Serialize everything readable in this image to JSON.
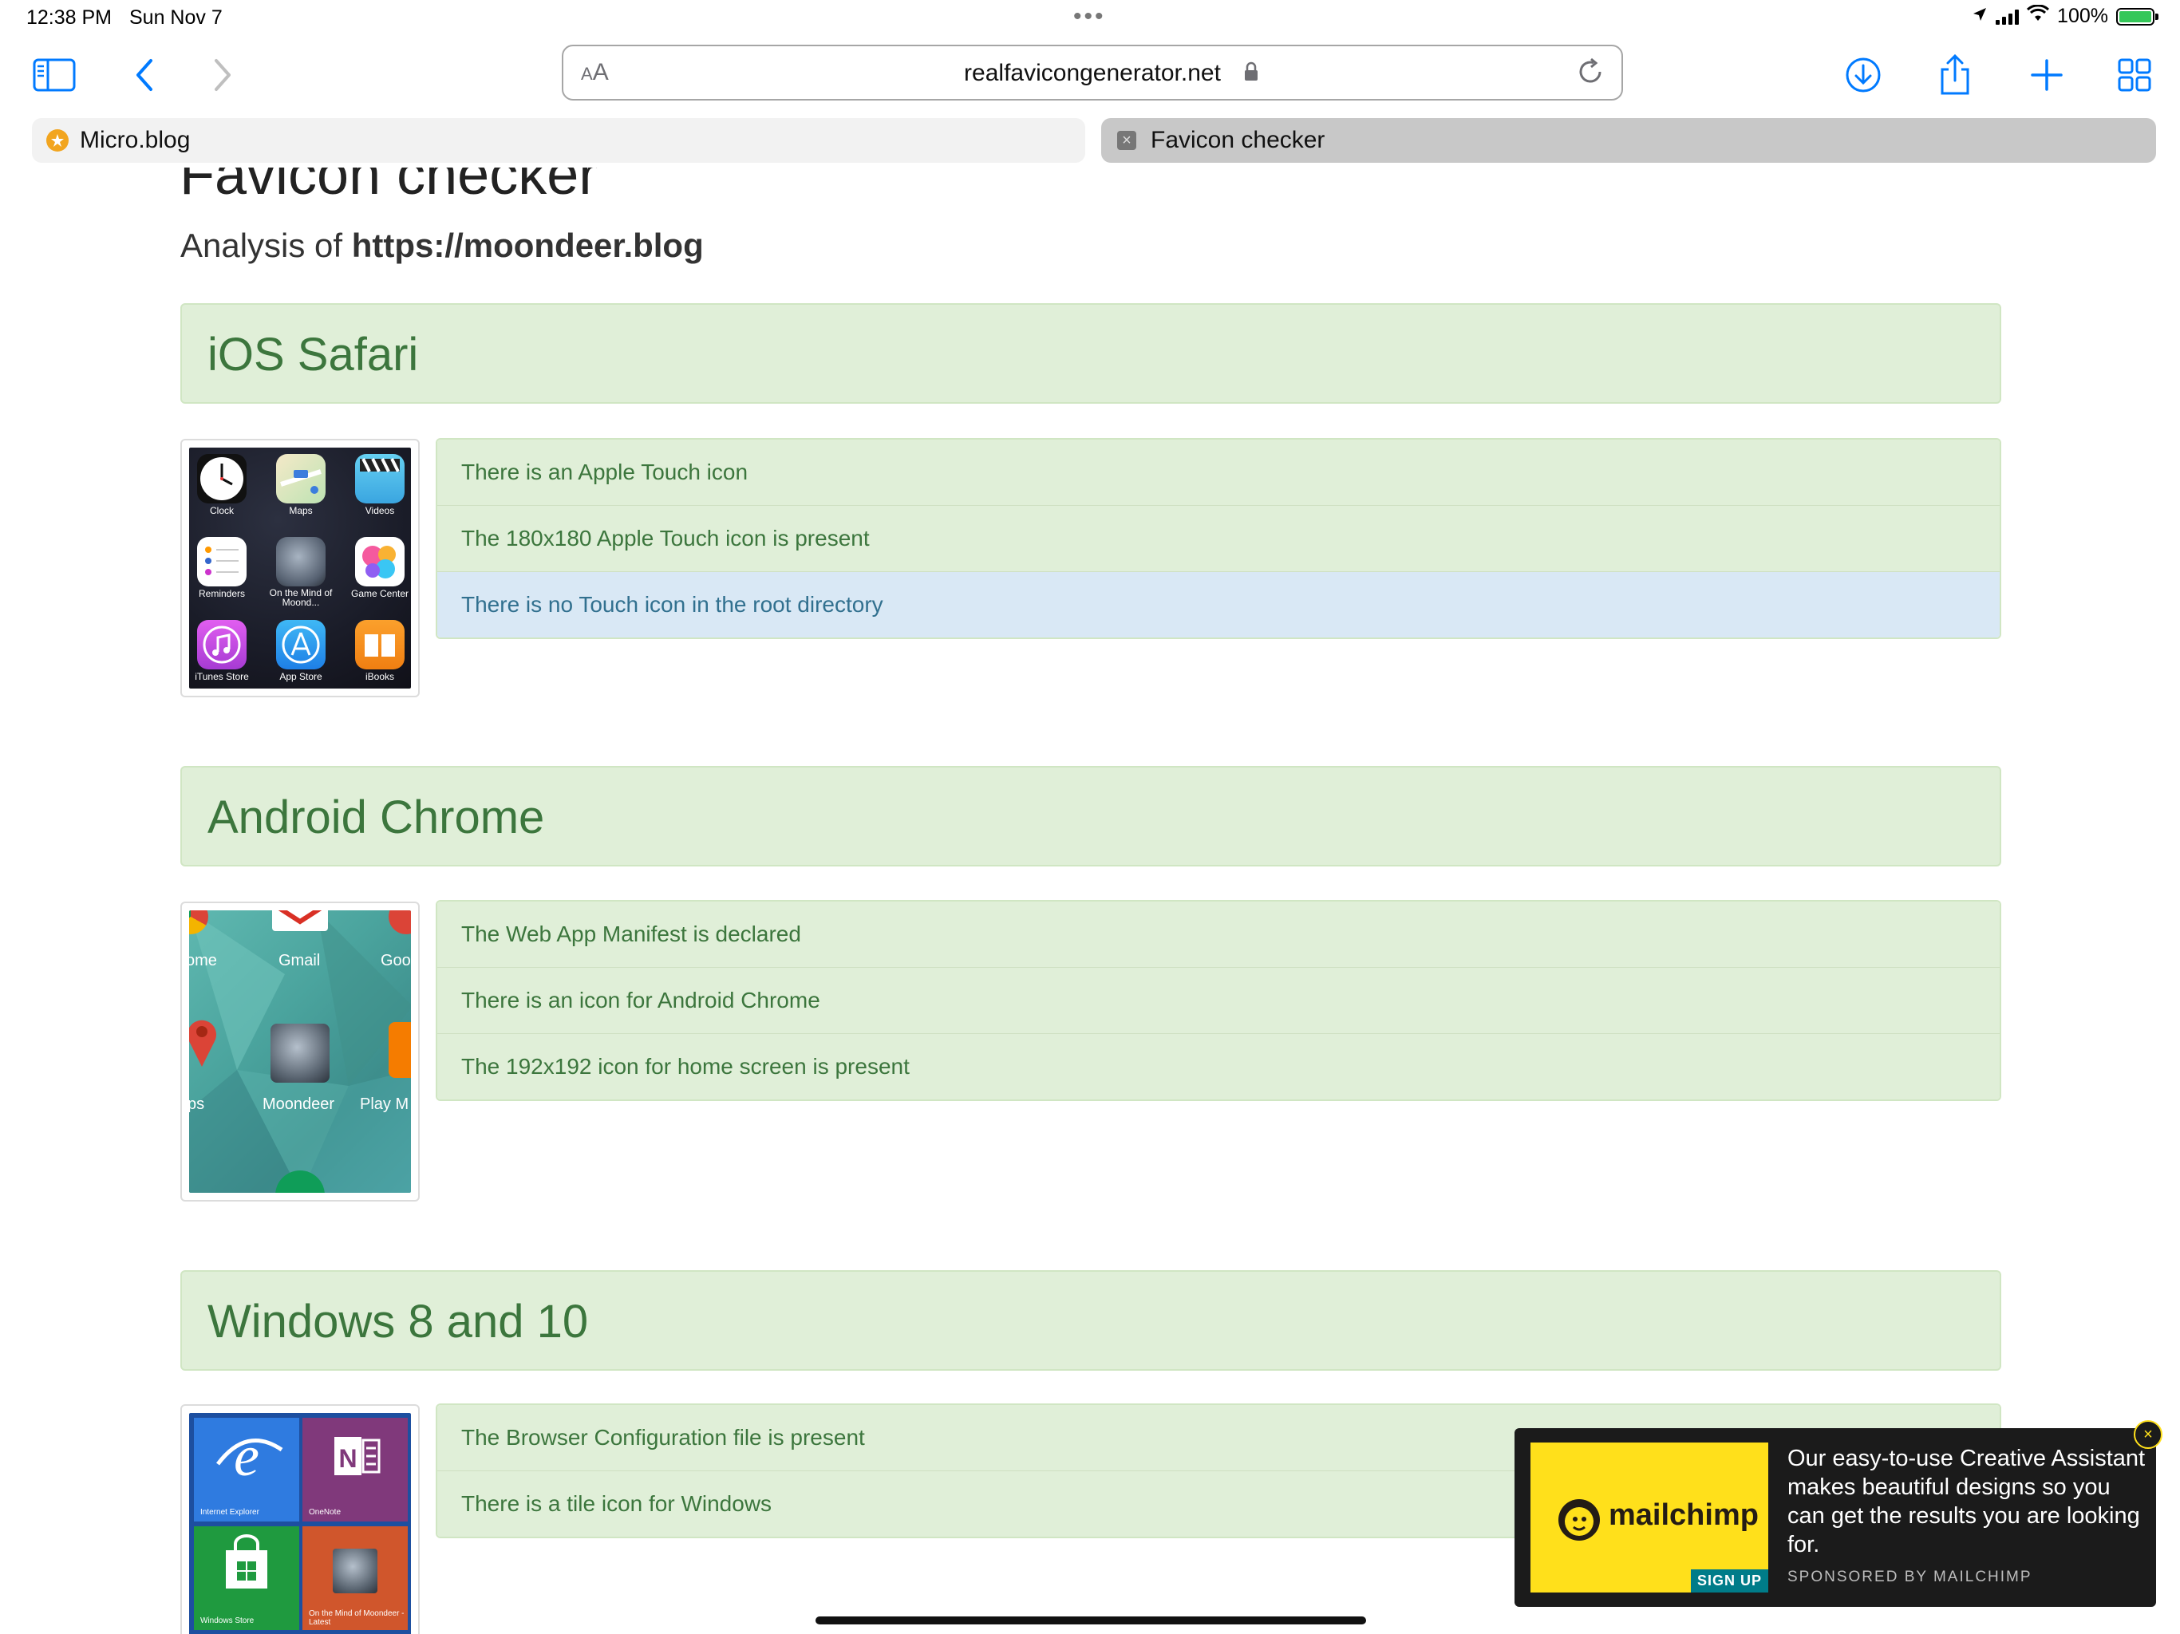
{
  "status": {
    "time": "12:38 PM",
    "date": "Sun Nov 7",
    "battery": "100%"
  },
  "browser": {
    "address_aa": "AA",
    "url": "realfavicongenerator.net",
    "tabs": [
      {
        "label": "Micro.blog",
        "active": false
      },
      {
        "label": "Favicon checker",
        "active": true
      }
    ]
  },
  "page": {
    "title": "Favicon checker",
    "analysis_prefix": "Analysis of",
    "analysis_url": "https://moondeer.blog",
    "sections": [
      {
        "heading": "iOS Safari",
        "messages": [
          {
            "text": "There is an Apple Touch icon",
            "kind": "success"
          },
          {
            "text": "The 180x180 Apple Touch icon is present",
            "kind": "success"
          },
          {
            "text": "There is no Touch icon in the root directory",
            "kind": "info"
          }
        ],
        "thumb_labels": [
          "Clock",
          "Maps",
          "Videos",
          "Reminders",
          "On the Mind of Moond...",
          "Game Center",
          "iTunes Store",
          "App Store",
          "iBooks"
        ]
      },
      {
        "heading": "Android Chrome",
        "messages": [
          {
            "text": "The Web App Manifest is declared",
            "kind": "success"
          },
          {
            "text": "There is an icon for Android Chrome",
            "kind": "success"
          },
          {
            "text": "The 192x192 icon for home screen is present",
            "kind": "success"
          }
        ],
        "thumb_labels": [
          "ome",
          "Gmail",
          "Goo",
          "ps",
          "Moondeer",
          "Play M"
        ]
      },
      {
        "heading": "Windows 8 and 10",
        "messages": [
          {
            "text": "The Browser Configuration file is present",
            "kind": "success"
          },
          {
            "text": "There is a tile icon for Windows",
            "kind": "success"
          }
        ],
        "thumb_labels": [
          "Internet Explorer",
          "OneNote",
          "Windows Store",
          "On the Mind of Moondeer - Latest"
        ]
      }
    ]
  },
  "ad": {
    "brand": "mailchimp",
    "cta": "SIGN UP",
    "text": "Our easy-to-use Creative Assistant makes beautiful designs so you can get the results you are looking for.",
    "sponsor": "SPONSORED BY MAILCHIMP",
    "close": "×"
  },
  "colors": {
    "success_bg": "#e0efd8",
    "success_text": "#3c763d",
    "info_bg": "#d9e8f5",
    "info_text": "#31708f",
    "ios_blue": "#007aff",
    "mailchimp_yellow": "#ffe01b"
  },
  "icons": [
    "sidebar-icon",
    "back-icon",
    "forward-icon",
    "lock-icon",
    "reload-icon",
    "download-icon",
    "share-icon",
    "new-tab-icon",
    "tab-overview-icon",
    "location-icon",
    "wifi-icon",
    "battery-icon"
  ]
}
